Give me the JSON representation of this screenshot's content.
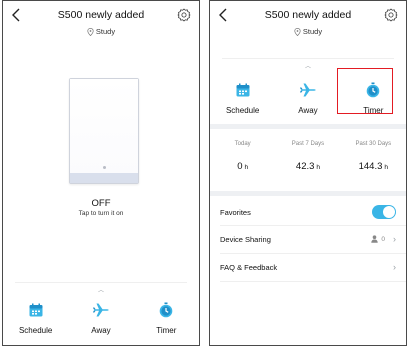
{
  "device": {
    "title": "S500 newly added",
    "location": "Study"
  },
  "left": {
    "status": "OFF",
    "hint": "Tap to turn it on"
  },
  "actions": [
    {
      "label": "Schedule",
      "icon": "calendar-icon"
    },
    {
      "label": "Away",
      "icon": "airplane-icon"
    },
    {
      "label": "Timer",
      "icon": "timer-icon"
    }
  ],
  "usage": {
    "today": {
      "label": "Today",
      "value": "0",
      "unit": "h"
    },
    "past7": {
      "label": "Past 7 Days",
      "value": "42.3",
      "unit": "h"
    },
    "past30": {
      "label": "Past 30 Days",
      "value": "144.3",
      "unit": "h"
    }
  },
  "settings": {
    "favorites": {
      "label": "Favorites",
      "enabled": true
    },
    "sharing": {
      "label": "Device Sharing",
      "count": "0"
    },
    "faq": {
      "label": "FAQ & Feedback"
    }
  },
  "colors": {
    "accent": "#3ab5e6",
    "highlight": "#e31b23"
  }
}
